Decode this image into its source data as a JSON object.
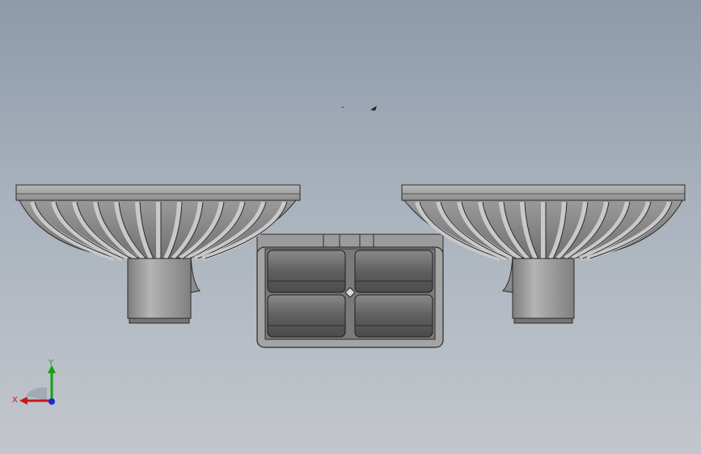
{
  "viewport": {
    "background_top": "#8e9aaa",
    "background_bottom": "#c3c7cc"
  },
  "model": {
    "description_icon": "cad-3d-model",
    "body_color": "#8a8a8a",
    "edge_color": "#2b2b2b",
    "rib_count_per_basket": 12
  },
  "triad": {
    "x_label": "X",
    "y_label": "Y",
    "x_color": "#c81818",
    "y_color": "#16a016",
    "z_color": "#1830c8"
  }
}
